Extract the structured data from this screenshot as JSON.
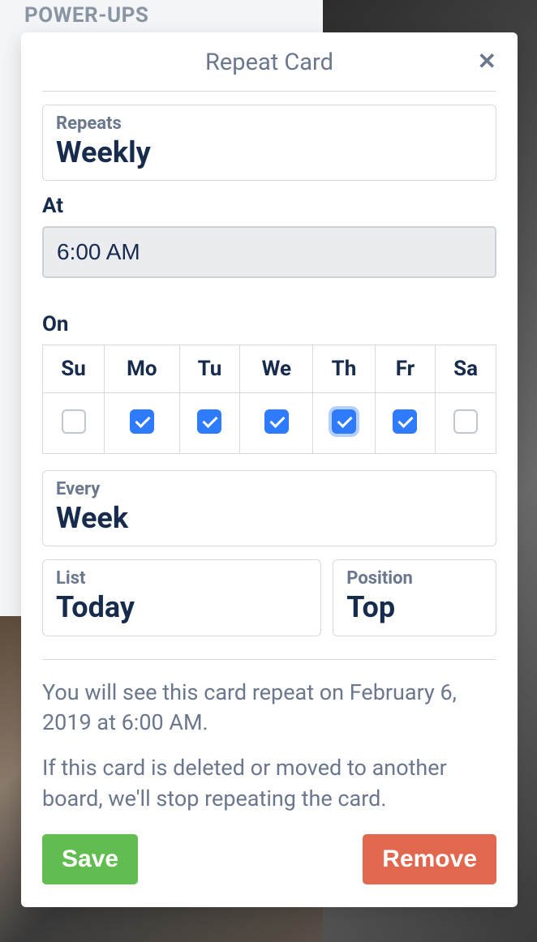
{
  "sidebar": {
    "section_label": "POWER-UPS"
  },
  "popover": {
    "title": "Repeat Card",
    "repeats": {
      "label": "Repeats",
      "value": "Weekly"
    },
    "at": {
      "label": "At",
      "value": "6:00 AM"
    },
    "on": {
      "label": "On",
      "days": [
        {
          "abbr": "Su",
          "checked": false,
          "focused": false
        },
        {
          "abbr": "Mo",
          "checked": true,
          "focused": false
        },
        {
          "abbr": "Tu",
          "checked": true,
          "focused": false
        },
        {
          "abbr": "We",
          "checked": true,
          "focused": false
        },
        {
          "abbr": "Th",
          "checked": true,
          "focused": true
        },
        {
          "abbr": "Fr",
          "checked": true,
          "focused": false
        },
        {
          "abbr": "Sa",
          "checked": false,
          "focused": false
        }
      ]
    },
    "every": {
      "label": "Every",
      "value": "Week"
    },
    "list": {
      "label": "List",
      "value": "Today"
    },
    "position": {
      "label": "Position",
      "value": "Top"
    },
    "info_next": "You will see this card repeat on February 6, 2019 at 6:00 AM.",
    "info_warn": "If this card is deleted or moved to another board, we'll stop repeating the card.",
    "buttons": {
      "save": "Save",
      "remove": "Remove"
    }
  }
}
